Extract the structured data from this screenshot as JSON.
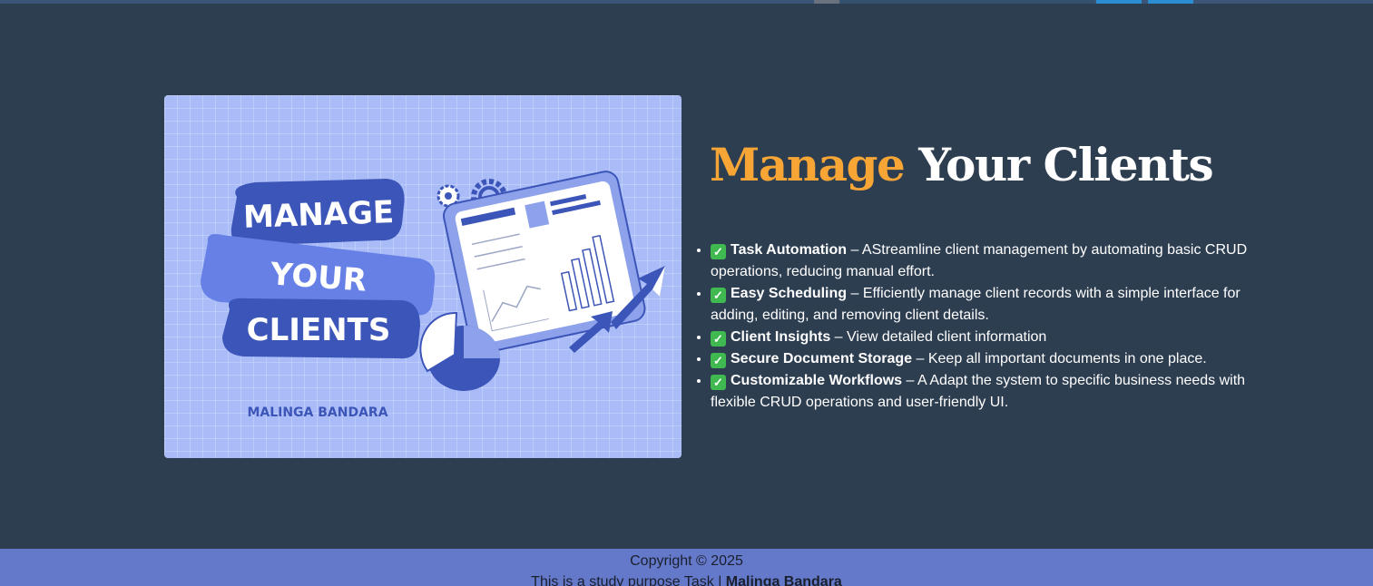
{
  "hero_image": {
    "line1": "MANAGE",
    "line2": "YOUR",
    "line3": "CLIENTS",
    "author": "MALINGA BANDARA"
  },
  "heading": {
    "accent": "Manage",
    "rest": " Your Clients"
  },
  "features": [
    {
      "icon": "check-mark-icon",
      "check": "✓",
      "title": "Task Automation",
      "text": " – AStreamline client management by automating basic CRUD operations, reducing manual effort."
    },
    {
      "icon": "check-mark-icon",
      "check": "✓",
      "title": "Easy Scheduling",
      "text": " – Efficiently manage client records with a simple interface for adding, editing, and removing client details."
    },
    {
      "icon": "check-mark-icon",
      "check": "✓",
      "title": "Client Insights",
      "text": " – View detailed client information"
    },
    {
      "icon": "check-mark-icon",
      "check": "✓",
      "title": "Secure Document Storage",
      "text": " – Keep all important documents in one place."
    },
    {
      "icon": "check-mark-icon",
      "check": "✓",
      "title": "Customizable Workflows",
      "text": " – A Adapt the system to specific business needs with flexible CRUD operations and user-friendly UI."
    }
  ],
  "footer": {
    "copyright": "Copyright © 2025",
    "study_text": "This is a study purpose Task | ",
    "author": "Malinga Bandara"
  },
  "colors": {
    "background": "#2e3e51",
    "accent": "#f7a636",
    "footer": "#6479c9",
    "check": "#3fb950"
  }
}
